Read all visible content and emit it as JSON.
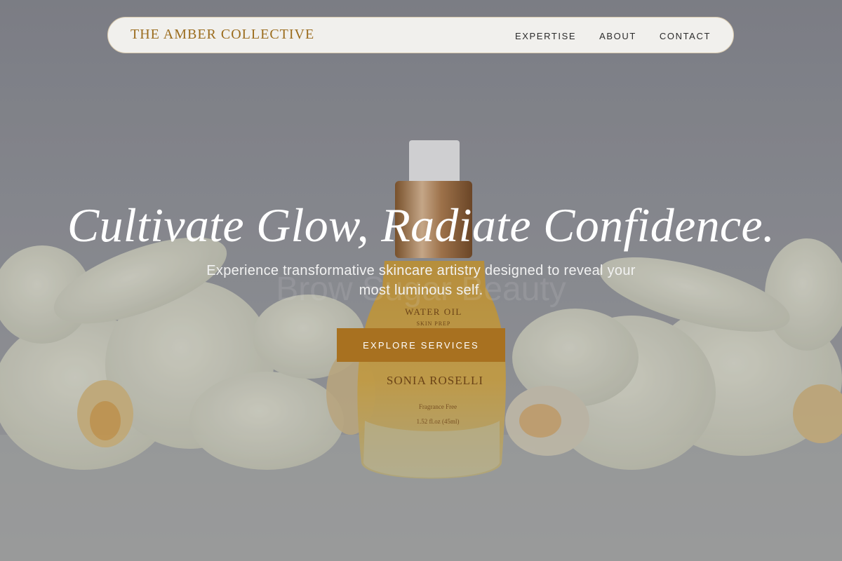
{
  "nav": {
    "brand": "THE AMBER COLLECTIVE",
    "links": [
      "EXPERTISE",
      "ABOUT",
      "CONTACT"
    ]
  },
  "hero": {
    "headline": "Cultivate Glow, Radiate Confidence.",
    "subtitle": "Experience transformative skincare artistry designed to reveal your most luminous self.",
    "cta_label": "EXPLORE SERVICES",
    "product_label": {
      "line1": "WATER OIL",
      "line2": "SKIN PREP",
      "brand": "SONIA ROSELLI",
      "note": "Fragrance Free",
      "volume": "1.52 fl.oz (45ml)"
    },
    "watermark": "Brow Sugar Beauty"
  },
  "colors": {
    "accent": "#a87120",
    "brand_text": "#9b6c1d",
    "nav_bg": "#f1f0ed"
  }
}
